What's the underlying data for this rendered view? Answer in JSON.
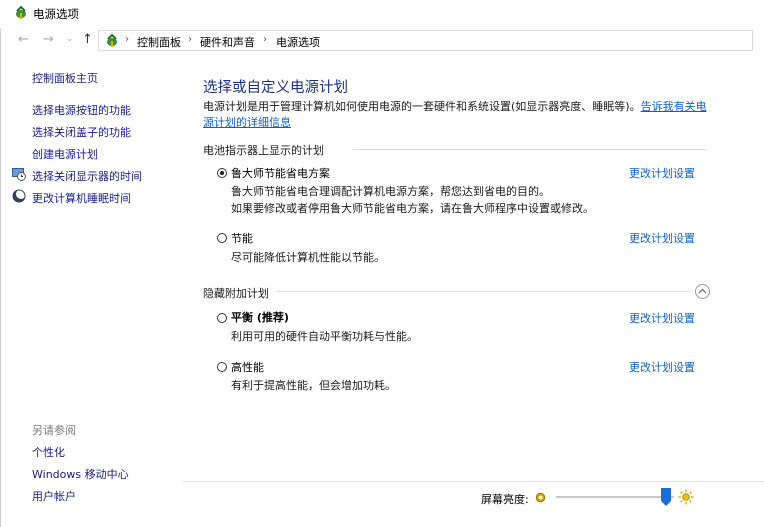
{
  "window": {
    "title": "电源选项",
    "icon": "power-options-icon"
  },
  "nav": {
    "back_icon": "arrow-left-icon",
    "forward_icon": "arrow-right-icon",
    "recent_icon": "chevron-down-icon",
    "up_icon": "arrow-up-icon",
    "breadcrumbs": [
      "控制面板",
      "硬件和声音",
      "电源选项"
    ]
  },
  "sidebar": {
    "home": "控制面板主页",
    "items": [
      {
        "label": "选择电源按钮的功能",
        "icon": null
      },
      {
        "label": "选择关闭盖子的功能",
        "icon": null
      },
      {
        "label": "创建电源计划",
        "icon": null
      },
      {
        "label": "选择关闭显示器的时间",
        "icon": "monitor-clock-icon"
      },
      {
        "label": "更改计算机睡眠时间",
        "icon": "moon-icon"
      }
    ]
  },
  "main": {
    "heading": "选择或自定义电源计划",
    "intro_text": "电源计划是用于管理计算机如何使用电源的一套硬件和系统设置(如显示器亮度、睡眠等)。",
    "intro_link": "告诉我有关电源计划的详细信息",
    "battery_section": "电池指示器上显示的计划",
    "hidden_section": "隐藏附加计划",
    "change_label": "更改计划设置",
    "plans": [
      {
        "name": "鲁大师节能省电方案",
        "checked": true,
        "desc1": "鲁大师节能省电合理调配计算机电源方案，帮您达到省电的目的。",
        "desc2": "如果要修改或者停用鲁大师节能省电方案，请在鲁大师程序中设置或修改。"
      },
      {
        "name": "节能",
        "checked": false,
        "desc1": "尽可能降低计算机性能以节能。"
      },
      {
        "name": "平衡 (推荐)",
        "checked": false,
        "desc1": "利用可用的硬件自动平衡功耗与性能。"
      },
      {
        "name": "高性能",
        "checked": false,
        "desc1": "有利于提高性能，但会增加功耗。"
      }
    ]
  },
  "see_also": {
    "title": "另请参阅",
    "links": [
      "个性化",
      "Windows 移动中心",
      "用户帐户"
    ]
  },
  "brightness": {
    "label": "屏幕亮度:",
    "level": 0.93,
    "thumb_color": "#1a6fd1"
  }
}
